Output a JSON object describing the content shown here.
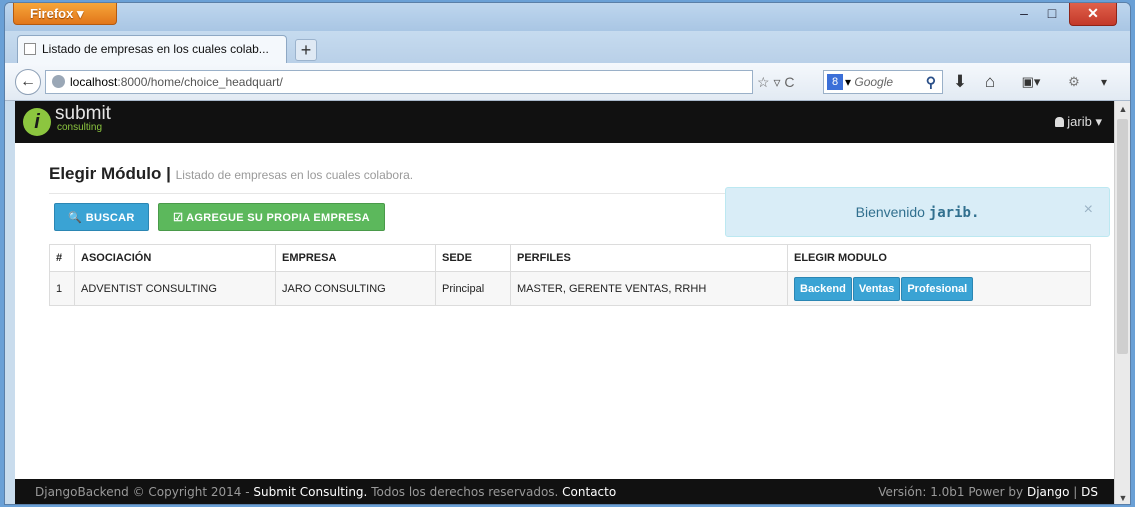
{
  "browser": {
    "menu_label": "Firefox ▾",
    "window_controls": {
      "minimize": "–",
      "maximize": "□",
      "close": "✕"
    },
    "tab": {
      "title": "Listado de empresas en los cuales colab..."
    },
    "new_tab_label": "+",
    "url": {
      "host": "localhost",
      "path": ":8000/home/choice_headquart/"
    },
    "nav_icons_text": "☆ ▿ C",
    "search": {
      "engine_badge": "8",
      "engine_arrow": "▾",
      "placeholder": "Google",
      "magnifier": "⚲"
    },
    "toolbar_icons": {
      "download": "⬇",
      "home": "⌂",
      "bookmarks": "▣▾",
      "extension": "⚙",
      "menu": "▾"
    }
  },
  "app": {
    "logo_mark": "i",
    "logo_text": "submit",
    "logo_subtext": "consulting",
    "user_menu": "jarib ▾",
    "page_title": "Elegir Módulo",
    "page_title_sep": "|",
    "page_subtitle": "Listado de empresas en los cuales colabora.",
    "buttons": {
      "buscar": "🔍 BUSCAR",
      "agregue": "☑ AGREGUE SU PROPIA EMPRESA"
    },
    "alert": {
      "prefix": "Bienvenido",
      "user": "jarib.",
      "close": "×"
    },
    "table": {
      "headers": [
        "#",
        "ASOCIACIÓN",
        "EMPRESA",
        "SEDE",
        "PERFILES",
        "ELEGIR MODULO"
      ],
      "rows": [
        {
          "num": "1",
          "asociacion": "ADVENTIST CONSULTING",
          "empresa": "JARO CONSULTING",
          "sede": "Principal",
          "perfiles": "MASTER, GERENTE VENTAS, RRHH",
          "modulos": [
            "Backend",
            "Ventas",
            "Profesional"
          ]
        }
      ]
    },
    "footer": {
      "left_prefix": "DjangoBackend © Copyright 2014 - ",
      "company": "Submit Consulting.",
      "rights": " Todos los derechos reservados. ",
      "contact": "Contacto",
      "version": "Versión: 1.0b1 Power by ",
      "django": "Django",
      "sep": " | ",
      "ds": "DS"
    }
  },
  "colors": {
    "primary": "#3aa3d4",
    "success": "#5cb85c",
    "navbar": "#111111",
    "alert_bg": "#d9edf7"
  }
}
